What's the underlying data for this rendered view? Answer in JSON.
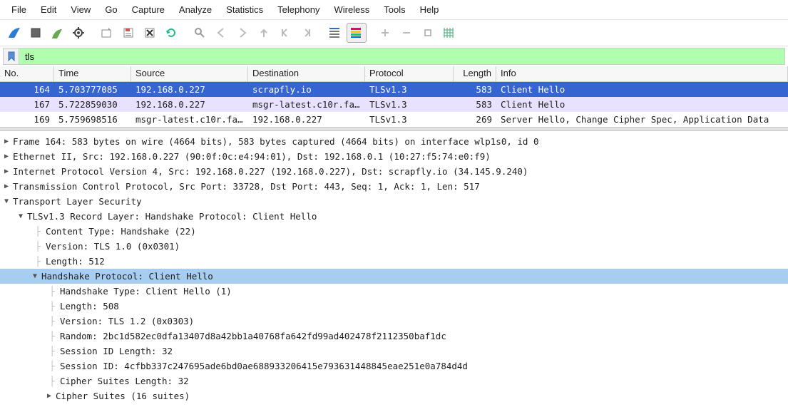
{
  "menu": [
    "File",
    "Edit",
    "View",
    "Go",
    "Capture",
    "Analyze",
    "Statistics",
    "Telephony",
    "Wireless",
    "Tools",
    "Help"
  ],
  "toolbar": {
    "icons": [
      "shark-fin-icon",
      "stop-icon",
      "restart-capture-icon",
      "options-icon",
      "sep",
      "open-icon",
      "save-icon",
      "close-icon",
      "reload-icon",
      "sep",
      "find-icon",
      "back-icon",
      "forward-icon",
      "goto-icon",
      "first-icon",
      "last-icon",
      "sep",
      "autoscroll-icon",
      "colorize-icon",
      "sep",
      "zoom-in-icon",
      "zoom-out-icon",
      "zoom-reset-icon",
      "resize-cols-icon"
    ]
  },
  "filter": {
    "value": "tls"
  },
  "columns": {
    "no": "No.",
    "time": "Time",
    "source": "Source",
    "destination": "Destination",
    "protocol": "Protocol",
    "length": "Length",
    "info": "Info"
  },
  "packets": [
    {
      "no": "164",
      "time": "5.703777085",
      "source": "192.168.0.227",
      "destination": "scrapfly.io",
      "protocol": "TLSv1.3",
      "length": "583",
      "info": "Client Hello",
      "selected": true
    },
    {
      "no": "167",
      "time": "5.722859030",
      "source": "192.168.0.227",
      "destination": "msgr-latest.c10r.fa…",
      "protocol": "TLSv1.3",
      "length": "583",
      "info": "Client Hello",
      "alt": true
    },
    {
      "no": "169",
      "time": "5.759698516",
      "source": "msgr-latest.c10r.fa…",
      "destination": "192.168.0.227",
      "protocol": "TLSv1.3",
      "length": "269",
      "info": "Server Hello, Change Cipher Spec, Application Data"
    }
  ],
  "details": {
    "frame": "Frame 164: 583 bytes on wire (4664 bits), 583 bytes captured (4664 bits) on interface wlp1s0, id 0",
    "ethernet": "Ethernet II, Src: 192.168.0.227 (90:0f:0c:e4:94:01), Dst: 192.168.0.1 (10:27:f5:74:e0:f9)",
    "ip": "Internet Protocol Version 4, Src: 192.168.0.227 (192.168.0.227), Dst: scrapfly.io (34.145.9.240)",
    "tcp": "Transmission Control Protocol, Src Port: 33728, Dst Port: 443, Seq: 1, Ack: 1, Len: 517",
    "tls": "Transport Layer Security",
    "record": "TLSv1.3 Record Layer: Handshake Protocol: Client Hello",
    "content_type": "Content Type: Handshake (22)",
    "rec_version": "Version: TLS 1.0 (0x0301)",
    "rec_length": "Length: 512",
    "handshake": "Handshake Protocol: Client Hello",
    "hs_type": "Handshake Type: Client Hello (1)",
    "hs_length": "Length: 508",
    "hs_version": "Version: TLS 1.2 (0x0303)",
    "random": "Random: 2bc1d582ec0dfa13407d8a42bb1a40768fa642fd99ad402478f2112350baf1dc",
    "sid_len": "Session ID Length: 32",
    "sid": "Session ID: 4cfbb337c247695ade6bd0ae688933206415e793631448845eae251e0a784d4d",
    "cs_len": "Cipher Suites Length: 32",
    "cs": "Cipher Suites (16 suites)"
  }
}
